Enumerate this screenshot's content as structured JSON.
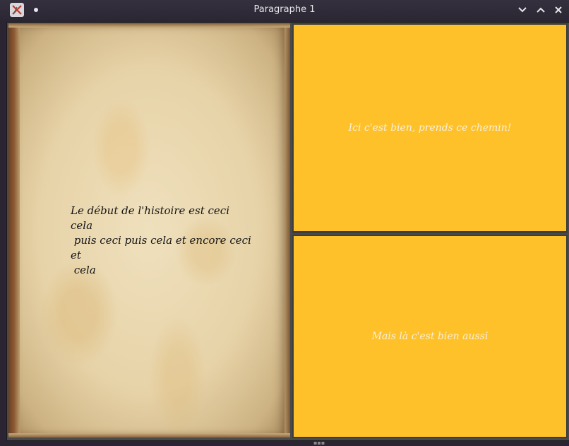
{
  "window": {
    "title": "Paragraphe 1",
    "icon": "app-x-icon",
    "controls": [
      "minimize-chevron-down-icon",
      "maximize-chevron-up-icon",
      "close-icon"
    ]
  },
  "story": {
    "text": "Le début de l'histoire est ceci cela\n puis ceci puis cela et encore ceci et\n cela"
  },
  "choices": [
    {
      "label": "Ici c'est bien, prends ce chemin!"
    },
    {
      "label": "Mais là c'est bien aussi"
    }
  ],
  "colors": {
    "choice_bg": "#fec12a",
    "choice_text": "#f8f0dc",
    "titlebar_bg": "#2b2733"
  }
}
